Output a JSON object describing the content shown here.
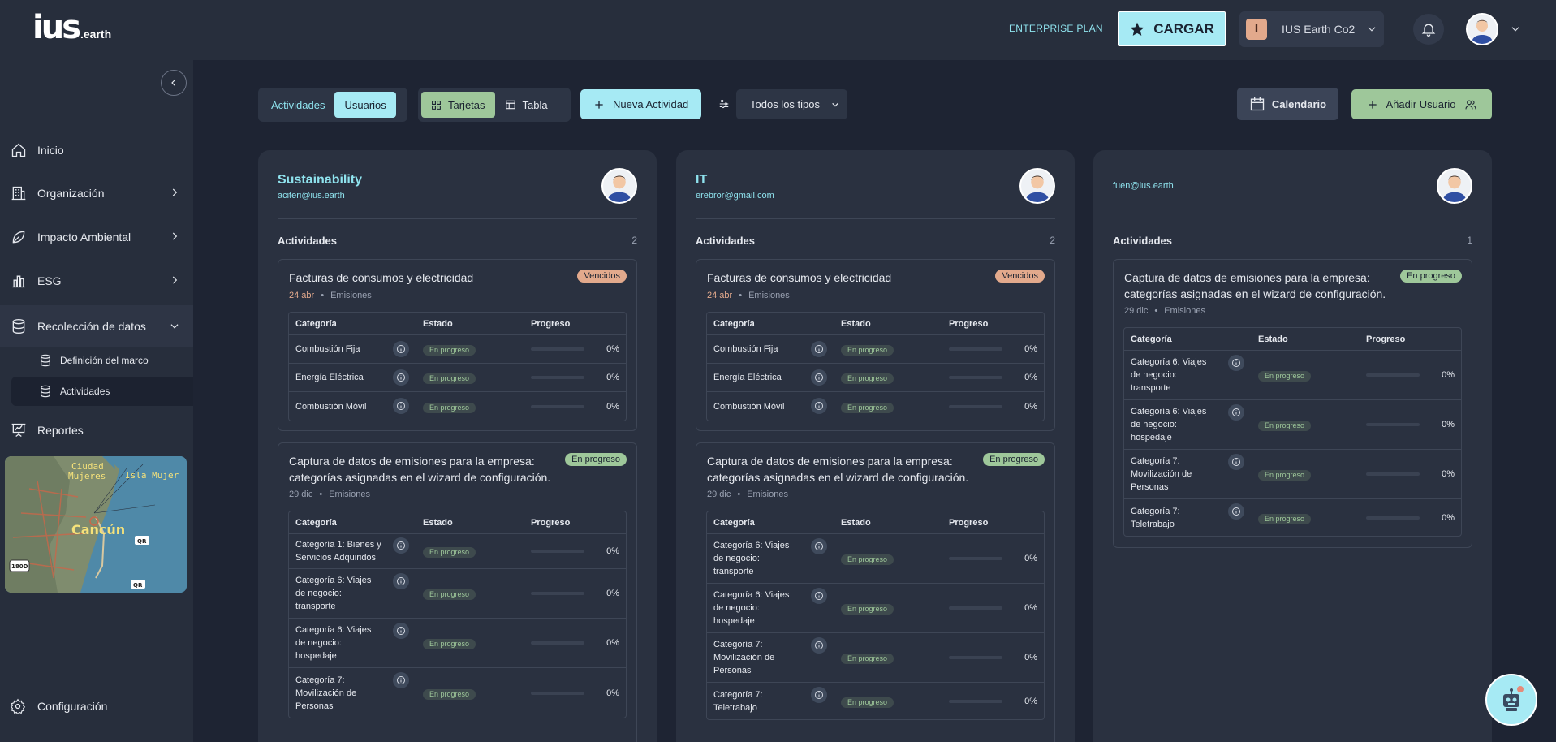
{
  "brand": {
    "logo_main": "ius",
    "logo_sub": ".earth"
  },
  "header": {
    "plan": "ENTERPRISE PLAN",
    "cargar": "CARGAR",
    "org_initial": "I",
    "org_name": "IUS Earth Co2"
  },
  "sidebar": {
    "items": [
      {
        "label": "Inicio",
        "icon": "home-icon"
      },
      {
        "label": "Organización",
        "icon": "building-icon"
      },
      {
        "label": "Impacto Ambiental",
        "icon": "leaf-icon"
      },
      {
        "label": "ESG",
        "icon": "chart-icon"
      },
      {
        "label": "Recolección de datos",
        "icon": "database-icon"
      },
      {
        "label": "Reportes",
        "icon": "report-icon"
      }
    ],
    "sub_items": [
      {
        "label": "Definición del marco"
      },
      {
        "label": "Actividades"
      }
    ],
    "map": {
      "labels": [
        "Ciudad",
        "Mujeres",
        "Isla Mujer",
        "Cancún",
        "QR",
        "QR",
        "180D"
      ]
    },
    "config": "Configuración"
  },
  "toolbar": {
    "view_toggle": [
      "Actividades",
      "Usuarios"
    ],
    "layout_toggle": [
      "Tarjetas",
      "Tabla"
    ],
    "new_activity": "Nueva Actividad",
    "type_filter": "Todos los tipos",
    "calendar": "Calendario",
    "add_user": "Añadir Usuario"
  },
  "labels": {
    "activities": "Actividades",
    "col_cat": "Categoría",
    "col_state": "Estado",
    "col_prog": "Progreso",
    "status_progress": "En progreso",
    "pct": "0%",
    "dot": "•"
  },
  "columns": [
    {
      "name": "Sustainability",
      "email": "aciteri@ius.earth",
      "count": "2",
      "cards": [
        {
          "title": "Facturas de consumos y electricidad",
          "badge": "Vencidos",
          "date": "24 abr",
          "type": "Emisiones",
          "rows": [
            "Combustión Fija",
            "Energía Eléctrica",
            "Combustión Móvil"
          ]
        },
        {
          "title": "Captura de datos de emisiones para la empresa: categorías asignadas en el wizard de configuración.",
          "badge": "En progreso",
          "date": "29 dic",
          "type": "Emisiones",
          "rows": [
            "Categoría 1: Bienes y Servicios Adquiridos",
            "Categoría 6: Viajes de negocio: transporte",
            "Categoría 6: Viajes de negocio: hospedaje",
            "Categoría 7: Movilización de Personas"
          ]
        }
      ]
    },
    {
      "name": "IT",
      "email": "erebror@gmail.com",
      "count": "2",
      "cards": [
        {
          "title": "Facturas de consumos y electricidad",
          "badge": "Vencidos",
          "date": "24 abr",
          "type": "Emisiones",
          "rows": [
            "Combustión Fija",
            "Energía Eléctrica",
            "Combustión Móvil"
          ]
        },
        {
          "title": "Captura de datos de emisiones para la empresa: categorías asignadas en el wizard de configuración.",
          "badge": "En progreso",
          "date": "29 dic",
          "type": "Emisiones",
          "rows": [
            "Categoría 6: Viajes de negocio: transporte",
            "Categoría 6: Viajes de negocio: hospedaje",
            "Categoría 7: Movilización de Personas",
            "Categoría 7: Teletrabajo"
          ]
        }
      ]
    },
    {
      "name": "",
      "email": "fuen@ius.earth",
      "count": "1",
      "cards": [
        {
          "title": "Captura de datos de emisiones para la empresa: categorías asignadas en el wizard de configuración.",
          "badge": "En progreso",
          "date": "29 dic",
          "type": "Emisiones",
          "rows": [
            "Categoría 6: Viajes de negocio: transporte",
            "Categoría 6: Viajes de negocio: hospedaje",
            "Categoría 7: Movilización de Personas",
            "Categoría 7: Teletrabajo"
          ]
        }
      ]
    }
  ],
  "colors": {
    "accent": "#a6eaf4",
    "green": "#9ec79a",
    "overdue": "#e2a98c",
    "bg": "#1e2433",
    "panel": "#272e3c"
  }
}
